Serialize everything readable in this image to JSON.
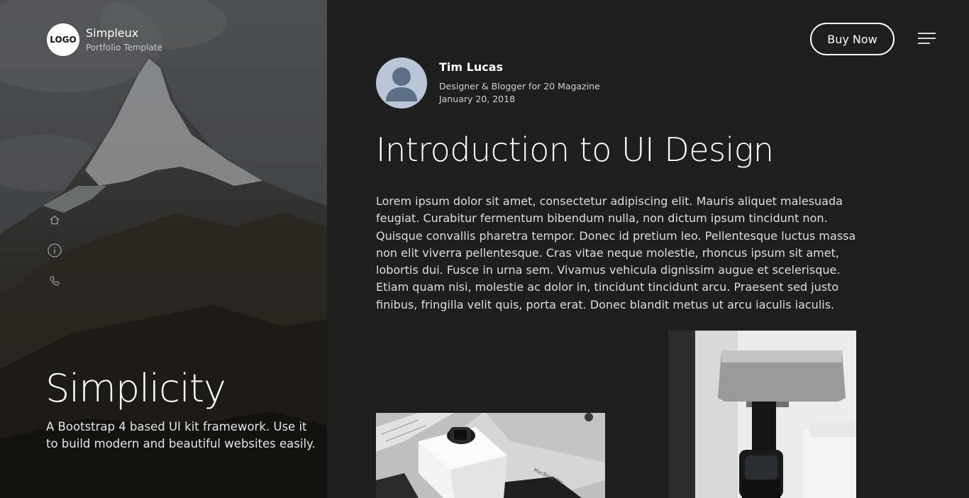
{
  "brand": {
    "logo_text": "LOGO",
    "name": "Simpleux",
    "subtitle": "Portfolio Template"
  },
  "side_nav": {
    "icons": [
      "home-icon",
      "info-icon",
      "phone-icon"
    ]
  },
  "hero": {
    "title": "Simplicity",
    "description": "A Bootstrap 4 based UI kit framework. Use it to build modern and beautiful websites easily."
  },
  "header": {
    "buy_label": "Buy Now",
    "menu_icon": "hamburger-menu-icon"
  },
  "author": {
    "name": "Tim Lucas",
    "role": "Designer & Blogger for 20 Magazine",
    "date": "January 20, 2018"
  },
  "article": {
    "title": "Introduction to UI Design",
    "body": "Lorem ipsum dolor sit amet, consectetur adipiscing elit. Mauris aliquet malesuada feugiat. Curabitur fermentum bibendum nulla, non dictum ipsum tincidunt non. Quisque convallis pharetra tempor. Donec id pretium leo. Pellentesque luctus massa non elit viverra pellentesque. Cras vitae neque molestie, rhoncus ipsum sit amet, lobortis dui. Fusce in urna sem. Vivamus vehicula dignissim augue et scelerisque. Etiam quam nisi, molestie ac dolor in, tincidunt tincidunt arcu. Praesent sed justo finibus, fringilla velit quis, porta erat. Donec blandit metus ut arcu iaculis iaculis."
  },
  "colors": {
    "page_background": "#1e1e1e",
    "text_primary": "#ffffff",
    "text_body": "#dedede",
    "avatar_background": "#b9c6d6",
    "avatar_figure": "#5c6f86"
  }
}
